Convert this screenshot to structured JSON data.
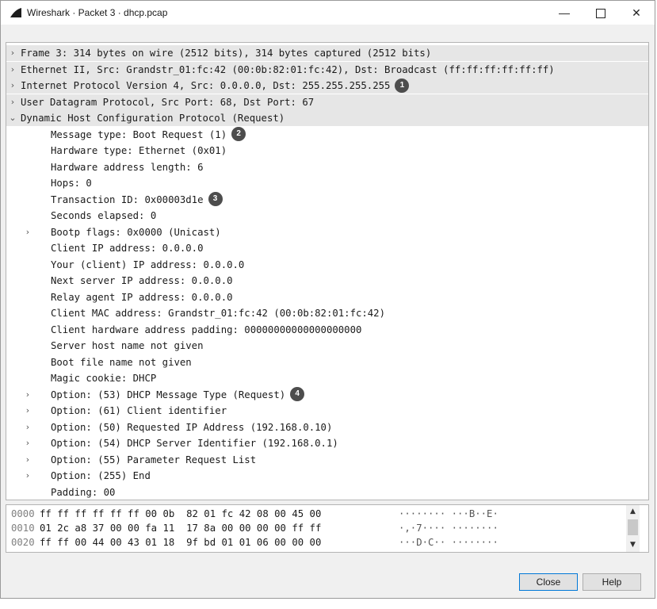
{
  "window": {
    "title": "Wireshark · Packet 3 · dhcp.pcap",
    "minimize": "—",
    "close": "✕"
  },
  "tree": [
    {
      "text": "Frame 3: 314 bytes on wire (2512 bits), 314 bytes captured (2512 bits)",
      "indent": 0,
      "arrow": "›",
      "shaded": true,
      "badge": ""
    },
    {
      "text": "Ethernet II, Src: Grandstr_01:fc:42 (00:0b:82:01:fc:42), Dst: Broadcast (ff:ff:ff:ff:ff:ff)",
      "indent": 0,
      "arrow": "›",
      "shaded": true,
      "badge": ""
    },
    {
      "text": "Internet Protocol Version 4, Src: 0.0.0.0, Dst: 255.255.255.255",
      "indent": 0,
      "arrow": "›",
      "shaded": true,
      "badge": "1"
    },
    {
      "text": "User Datagram Protocol, Src Port: 68, Dst Port: 67",
      "indent": 0,
      "arrow": "›",
      "shaded": true,
      "badge": ""
    },
    {
      "text": "Dynamic Host Configuration Protocol (Request)",
      "indent": 0,
      "arrow": "⌄",
      "shaded": true,
      "badge": ""
    },
    {
      "text": "Message type: Boot Request (1)",
      "indent": 1,
      "arrow": "",
      "shaded": false,
      "badge": "2"
    },
    {
      "text": "Hardware type: Ethernet (0x01)",
      "indent": 1,
      "arrow": "",
      "shaded": false,
      "badge": ""
    },
    {
      "text": "Hardware address length: 6",
      "indent": 1,
      "arrow": "",
      "shaded": false,
      "badge": ""
    },
    {
      "text": "Hops: 0",
      "indent": 1,
      "arrow": "",
      "shaded": false,
      "badge": ""
    },
    {
      "text": "Transaction ID: 0x00003d1e",
      "indent": 1,
      "arrow": "",
      "shaded": false,
      "badge": "3"
    },
    {
      "text": "Seconds elapsed: 0",
      "indent": 1,
      "arrow": "",
      "shaded": false,
      "badge": ""
    },
    {
      "text": "Bootp flags: 0x0000 (Unicast)",
      "indent": 1,
      "arrow": "›",
      "shaded": false,
      "badge": ""
    },
    {
      "text": "Client IP address: 0.0.0.0",
      "indent": 1,
      "arrow": "",
      "shaded": false,
      "badge": ""
    },
    {
      "text": "Your (client) IP address: 0.0.0.0",
      "indent": 1,
      "arrow": "",
      "shaded": false,
      "badge": ""
    },
    {
      "text": "Next server IP address: 0.0.0.0",
      "indent": 1,
      "arrow": "",
      "shaded": false,
      "badge": ""
    },
    {
      "text": "Relay agent IP address: 0.0.0.0",
      "indent": 1,
      "arrow": "",
      "shaded": false,
      "badge": ""
    },
    {
      "text": "Client MAC address: Grandstr_01:fc:42 (00:0b:82:01:fc:42)",
      "indent": 1,
      "arrow": "",
      "shaded": false,
      "badge": ""
    },
    {
      "text": "Client hardware address padding: 00000000000000000000",
      "indent": 1,
      "arrow": "",
      "shaded": false,
      "badge": ""
    },
    {
      "text": "Server host name not given",
      "indent": 1,
      "arrow": "",
      "shaded": false,
      "badge": ""
    },
    {
      "text": "Boot file name not given",
      "indent": 1,
      "arrow": "",
      "shaded": false,
      "badge": ""
    },
    {
      "text": "Magic cookie: DHCP",
      "indent": 1,
      "arrow": "",
      "shaded": false,
      "badge": ""
    },
    {
      "text": "Option: (53) DHCP Message Type (Request)",
      "indent": 1,
      "arrow": "›",
      "shaded": false,
      "badge": "4"
    },
    {
      "text": "Option: (61) Client identifier",
      "indent": 1,
      "arrow": "›",
      "shaded": false,
      "badge": ""
    },
    {
      "text": "Option: (50) Requested IP Address (192.168.0.10)",
      "indent": 1,
      "arrow": "›",
      "shaded": false,
      "badge": ""
    },
    {
      "text": "Option: (54) DHCP Server Identifier (192.168.0.1)",
      "indent": 1,
      "arrow": "›",
      "shaded": false,
      "badge": ""
    },
    {
      "text": "Option: (55) Parameter Request List",
      "indent": 1,
      "arrow": "›",
      "shaded": false,
      "badge": ""
    },
    {
      "text": "Option: (255) End",
      "indent": 1,
      "arrow": "›",
      "shaded": false,
      "badge": ""
    },
    {
      "text": "Padding: 00",
      "indent": 1,
      "arrow": "",
      "shaded": false,
      "badge": ""
    }
  ],
  "hex": [
    {
      "offset": "0000",
      "bytes": "ff ff ff ff ff ff 00 0b  82 01 fc 42 08 00 45 00",
      "ascii": "········ ···B··E·"
    },
    {
      "offset": "0010",
      "bytes": "01 2c a8 37 00 00 fa 11  17 8a 00 00 00 00 ff ff",
      "ascii": "·,·7···· ········"
    },
    {
      "offset": "0020",
      "bytes": "ff ff 00 44 00 43 01 18  9f bd 01 01 06 00 00 00",
      "ascii": "···D·C·· ········"
    }
  ],
  "scroll": {
    "up": "▲",
    "down": "▼"
  },
  "buttons": {
    "close": "Close",
    "help": "Help"
  }
}
